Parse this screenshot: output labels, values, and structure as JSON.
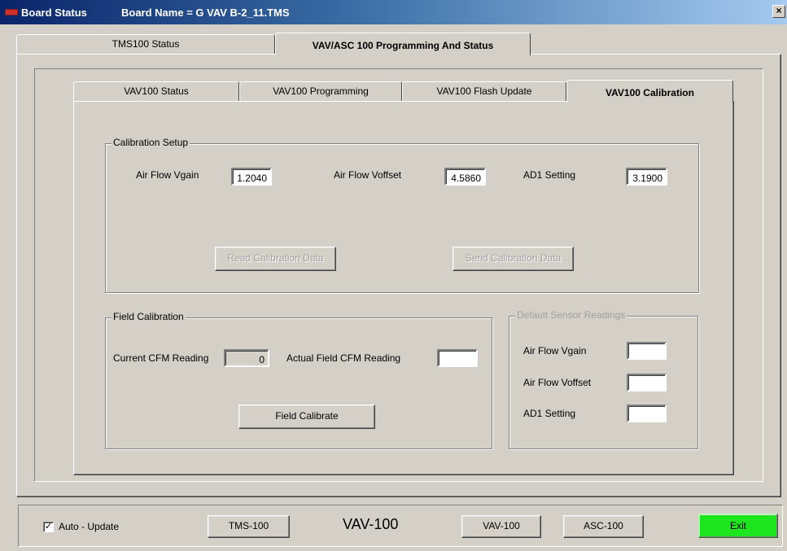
{
  "window": {
    "app_title": "Board Status",
    "board_title": "Board Name = G VAV B-2_11.TMS",
    "close_glyph": "×"
  },
  "outer_tabs": [
    "TMS100 Status",
    "VAV/ASC 100 Programming And Status"
  ],
  "inner_tabs": [
    "VAV100 Status",
    "VAV100 Programming",
    "VAV100 Flash Update",
    "VAV100 Calibration"
  ],
  "calibration_setup": {
    "title": "Calibration Setup",
    "air_flow_vgain_label": "Air Flow Vgain",
    "air_flow_vgain_value": "1.2040",
    "air_flow_voffset_label": "Air Flow Voffset",
    "air_flow_voffset_value": "4.5860",
    "ad1_setting_label": "AD1 Setting",
    "ad1_setting_value": "3.1900",
    "read_button": "Read Calibration Data",
    "send_button": "Send Calibration Data"
  },
  "field_calibration": {
    "title": "Field Calibration",
    "current_cfm_label": "Current CFM Reading",
    "current_cfm_value": "0",
    "actual_cfm_label": "Actual Field CFM Reading",
    "actual_cfm_value": "",
    "calibrate_button": "Field Calibrate"
  },
  "default_sensor": {
    "title": "Default Sensor Readings",
    "air_flow_vgain_label": "Air Flow Vgain",
    "air_flow_vgain_value": "",
    "air_flow_voffset_label": "Air Flow Voffset",
    "air_flow_voffset_value": "",
    "ad1_setting_label": "AD1 Setting",
    "ad1_setting_value": ""
  },
  "bottom_bar": {
    "auto_update_label": "Auto - Update",
    "auto_update_checked": true,
    "check_glyph": "✓",
    "tms_button": "TMS-100",
    "device_label": "VAV-100",
    "vav_button": "VAV-100",
    "asc_button": "ASC-100",
    "exit_button": "Exit"
  },
  "colors": {
    "exit_green": "#1ee61e",
    "titlebar_blue": "#0a246a",
    "face": "#d4d0c8"
  }
}
